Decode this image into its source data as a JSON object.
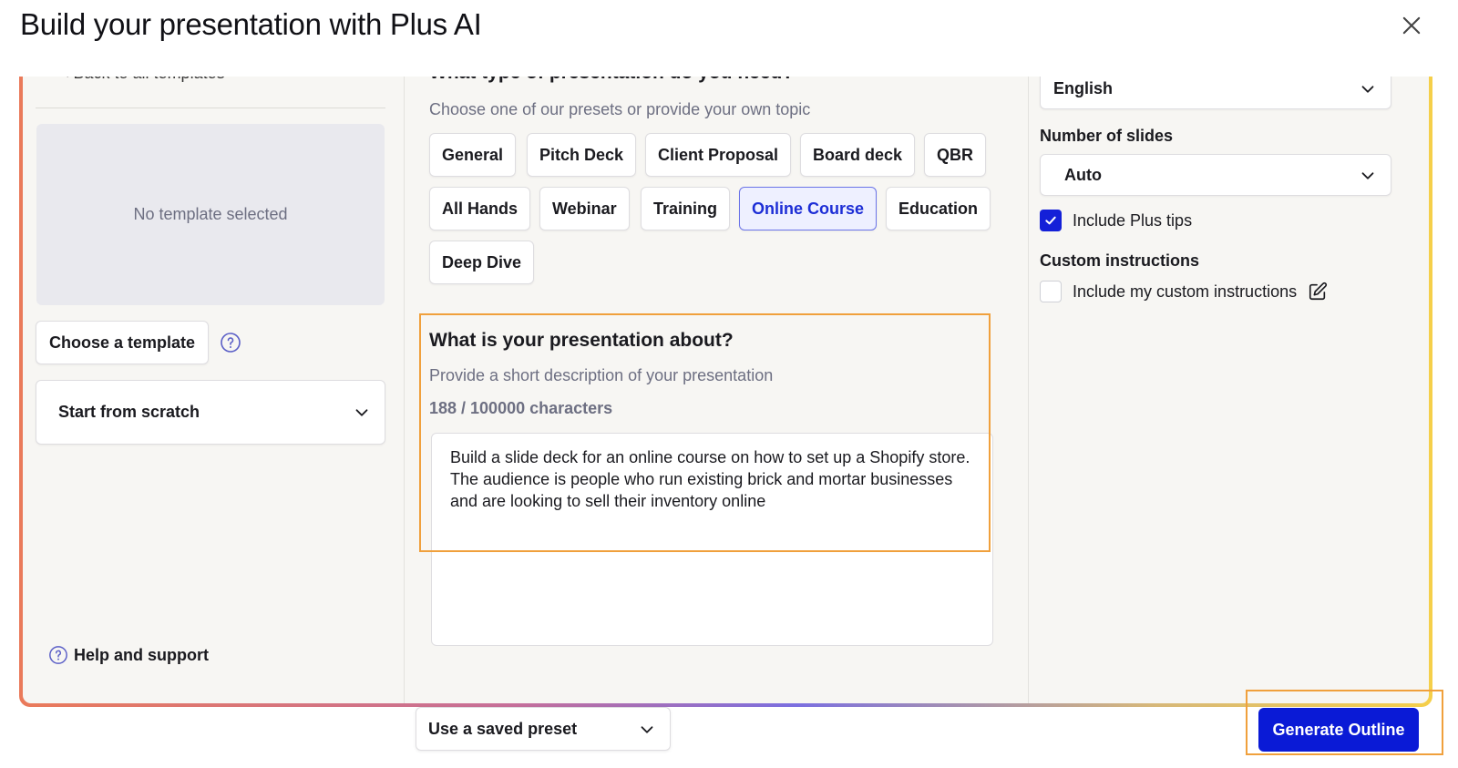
{
  "header": {
    "title": "Build your presentation with Plus AI"
  },
  "left": {
    "back_link": "< Back to all templates",
    "template_preview_text": "No template selected",
    "choose_template_label": "Choose a template",
    "scratch_select_value": "Start from scratch",
    "help_label": "Help and support"
  },
  "middle": {
    "type_heading": "What type of presentation do you need?",
    "type_subtitle": "Choose one of our presets or provide your own topic",
    "chips": [
      "General",
      "Pitch Deck",
      "Client Proposal",
      "Board deck",
      "QBR",
      "All Hands",
      "Webinar",
      "Training",
      "Online Course",
      "Education",
      "Deep Dive"
    ],
    "active_chip": "Online Course",
    "about_title": "What is your presentation about?",
    "about_subtitle": "Provide a short description of your presentation",
    "char_count": "188 / 100000 characters",
    "about_text": "Build a slide deck for an online course on how to set up a Shopify store. The audience is people who run existing brick and mortar businesses and are looking to sell their inventory online"
  },
  "right": {
    "language_value": "English",
    "slides_label": "Number of slides",
    "slides_value": "Auto",
    "tips_label": "Include Plus tips",
    "tips_checked": true,
    "custom_heading": "Custom instructions",
    "custom_label": "Include my custom instructions",
    "custom_checked": false
  },
  "footer": {
    "preset_select_value": "Use a saved preset",
    "generate_label": "Generate Outline"
  },
  "colors": {
    "primary": "#0a1ad6",
    "highlight_box": "#f0a03c",
    "active_chip_text": "#1d2ed6"
  }
}
